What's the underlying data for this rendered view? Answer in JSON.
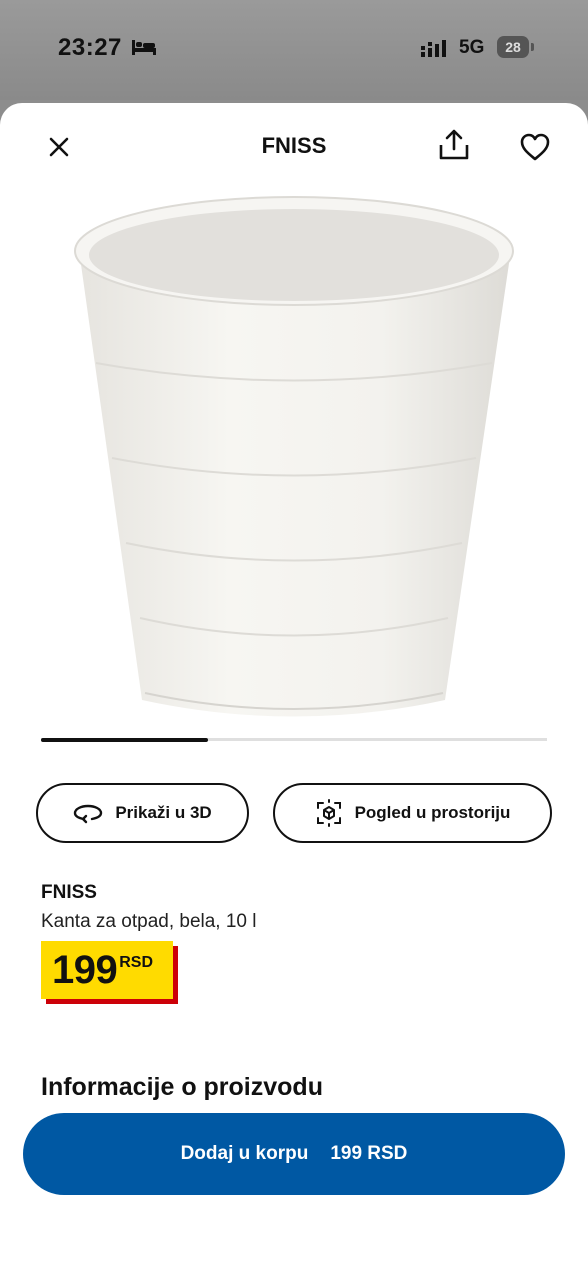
{
  "status_bar": {
    "time": "23:27",
    "network": "5G",
    "battery": "28"
  },
  "header": {
    "title": "FNISS"
  },
  "carousel": {
    "progress": 0.33
  },
  "actions": {
    "view_3d": "Prikaži u 3D",
    "view_room": "Pogled u prostoriju"
  },
  "product": {
    "name": "FNISS",
    "description": "Kanta za otpad, bela, 10 l",
    "price": "199",
    "currency": "RSD"
  },
  "section": {
    "title": "Informacije o proizvodu"
  },
  "cart": {
    "label": "Dodaj u korpu",
    "price": "199 RSD"
  },
  "colors": {
    "accent": "#0058a3",
    "price_yellow": "#ffdb00",
    "price_red": "#cc0008"
  }
}
